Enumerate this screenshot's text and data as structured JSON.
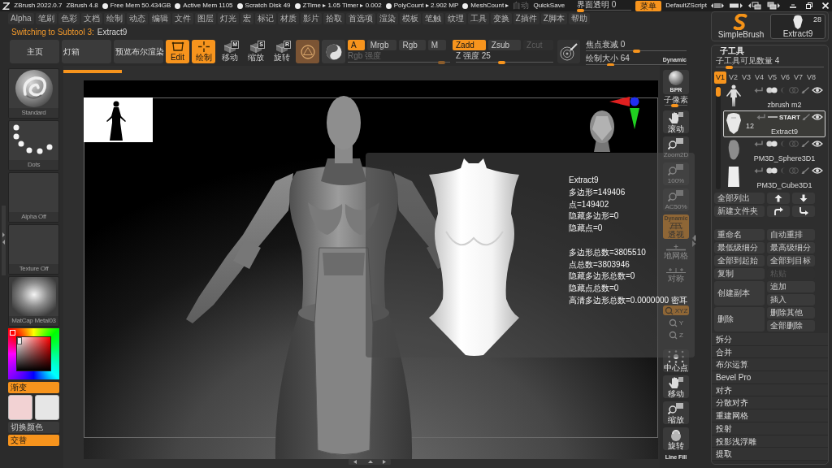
{
  "title_bar": {
    "app": "ZBrush 2022.0.7",
    "version": "ZBrush 4.8",
    "stats": [
      "Free Mem 50.434GB",
      "Active Mem 1105",
      "Scratch Disk 49",
      "ZTime ▸ 1.05 Timer ▸ 0.002",
      "PolyCount ▸ 2.902 MP",
      "MeshCount ▸"
    ],
    "autosave": {
      "label": "自动",
      "disabled": true
    },
    "quicksave": "QuickSave",
    "transparency": {
      "label": "界面透明 0",
      "level": 0
    },
    "menus_button": {
      "label": "菜单",
      "on": true
    },
    "script": "DefaultZScript"
  },
  "menu_bar": [
    "Alpha",
    "笔刷",
    "色彩",
    "文档",
    "绘制",
    "动态",
    "编辑",
    "文件",
    "图层",
    "灯光",
    "宏",
    "标记",
    "材质",
    "影片",
    "拾取",
    "首选项",
    "渲染",
    "模板",
    "笔触",
    "纹理",
    "工具",
    "变换",
    "Z插件",
    "Z脚本",
    "帮助"
  ],
  "note": {
    "prefix": "Switching to Subtool 3:",
    "value": "Extract9"
  },
  "toolbar": {
    "buttons": [
      "主页",
      "灯箱",
      "预览布尔渲染"
    ],
    "modes": [
      {
        "label": "Edit",
        "kind": "edit",
        "on": true
      },
      {
        "label": "绘制",
        "kind": "draw",
        "on": true
      },
      {
        "label": "移动",
        "kind": "move",
        "key": "M",
        "on": false
      },
      {
        "label": "缩放",
        "kind": "scale",
        "key": "S",
        "on": false
      },
      {
        "label": "旋转",
        "kind": "rotate",
        "key": "R",
        "on": false
      }
    ],
    "channels": [
      {
        "label": "A",
        "on": true
      },
      {
        "label": "Mrgb",
        "on": false
      },
      {
        "label": "Rgb",
        "on": false
      },
      {
        "label": "M",
        "on": false
      }
    ],
    "rgb_intensity": {
      "label": "Rgb 强度",
      "disabled": true,
      "level": 0.95
    },
    "z_modes": [
      {
        "label": "Zadd",
        "on": true,
        "disabled": false
      },
      {
        "label": "Zsub",
        "on": false,
        "disabled": false
      },
      {
        "label": "Zcut",
        "on": false,
        "disabled": true
      }
    ],
    "z_intensity": {
      "label": "Z 强度 25",
      "level": 0.47
    },
    "focal_shift": {
      "label": "焦点衰减 0",
      "level": 0.5
    },
    "draw_size": {
      "label": "绘制大小 64",
      "level": 0.23,
      "badge": "Dynamic"
    }
  },
  "brush_box": {
    "brush": "SimpleBrush",
    "tool": "Extract9",
    "count": "28"
  },
  "left_panel": {
    "tiles": [
      {
        "label": "Standard",
        "kind": "brush"
      },
      {
        "label": "Dots",
        "kind": "stroke"
      },
      {
        "label": "Alpha Off",
        "kind": "empty"
      },
      {
        "label": "Texture Off",
        "kind": "empty"
      },
      {
        "label": "MatCap Metal03",
        "kind": "material"
      }
    ],
    "gradient": {
      "label": "渐变",
      "on": true
    },
    "swatches": [
      {
        "color": "#f2d2d3"
      },
      {
        "color": "#e6e6e6"
      }
    ],
    "switch_label": "切换颜色",
    "alternate": {
      "label": "交替",
      "on": true
    }
  },
  "info_popup": {
    "title": "Extract9",
    "lines": [
      "多边形=149406",
      "点=149402",
      "隐藏多边形=0",
      "隐藏点=0"
    ],
    "totals": [
      "多边形总数=3805510",
      "点总数=3803946",
      "隐藏多边形总数=0",
      "隐藏点总数=0",
      "高清多边形总数=0.0000000 密耳"
    ]
  },
  "right_toolbar": {
    "render": "BPR",
    "subpixel": {
      "label": "子像素",
      "level": 0.4
    },
    "tools": [
      {
        "label": "滚动",
        "kind": "scroll",
        "on": false
      },
      {
        "label": "Zoom2D",
        "kind": "zoom",
        "on": false
      },
      {
        "label": "100%",
        "kind": "zoom",
        "on": false
      },
      {
        "label": "AC50%",
        "kind": "zoom",
        "on": false
      },
      {
        "label": "透视",
        "kind": "perspective",
        "on": true,
        "badge": "Dynamic"
      },
      {
        "label": "地网格",
        "kind": "floor",
        "on": false
      },
      {
        "label": "对称",
        "kind": "symmetry",
        "on": false
      },
      {
        "label": "XYZ",
        "kind": "axis",
        "on": true
      },
      {
        "label": "Y",
        "kind": "axis_small",
        "on": false
      },
      {
        "label": "Z",
        "kind": "axis_small",
        "on": false
      },
      {
        "label": "中心点",
        "kind": "frame",
        "on": false
      },
      {
        "label": "移动",
        "kind": "move",
        "on": false
      },
      {
        "label": "缩放",
        "kind": "zoom3d",
        "on": false
      },
      {
        "label": "旋转",
        "kind": "rotate",
        "on": false
      },
      {
        "label": "Line Fill",
        "kind": "text",
        "on": false
      }
    ]
  },
  "subtool": {
    "title": "子工具",
    "visible_count": {
      "label": "子工具可见数量 4",
      "level": 0.1
    },
    "versions": [
      {
        "label": "V1",
        "selected": true
      },
      {
        "label": "V2",
        "selected": false
      },
      {
        "label": "V3",
        "selected": false
      },
      {
        "label": "V4",
        "selected": false
      },
      {
        "label": "V5",
        "selected": false
      },
      {
        "label": "V6",
        "selected": false
      },
      {
        "label": "V7",
        "selected": false
      },
      {
        "label": "V8",
        "selected": false
      }
    ],
    "items": [
      {
        "name": "zbrush m2",
        "kind": "figure",
        "selected": false
      },
      {
        "name": "Extract9",
        "kind": "torso",
        "selected": true,
        "marker": "START",
        "count": "12"
      },
      {
        "name": "PM3D_Sphere3D1",
        "kind": "blob",
        "selected": false
      },
      {
        "name": "PM3D_Cube3D1",
        "kind": "block",
        "selected": false
      }
    ],
    "list_all": "全部列出",
    "new_folder": "新建文件夹",
    "actions": [
      {
        "label": "重命名",
        "disabled": false
      },
      {
        "label": "自动重排",
        "disabled": false
      },
      {
        "label": "最低级细分",
        "disabled": false
      },
      {
        "label": "最高级细分",
        "disabled": false
      },
      {
        "label": "全部到起始",
        "disabled": false
      },
      {
        "label": "全部到目标",
        "disabled": false
      },
      {
        "label": "复制",
        "disabled": false
      },
      {
        "label": "粘贴",
        "disabled": true
      }
    ],
    "duplicate": {
      "label": "创建副本",
      "options": [
        "追加",
        "插入"
      ]
    },
    "delete": {
      "label": "删除",
      "options": [
        "删除其他",
        "全部删除"
      ]
    },
    "sections": [
      "拆分",
      "合并",
      "布尔运算",
      "Bevel Pro",
      "对齐",
      "分散对齐",
      "重建网格",
      "投射",
      "投影浅浮雕",
      "提取"
    ]
  }
}
